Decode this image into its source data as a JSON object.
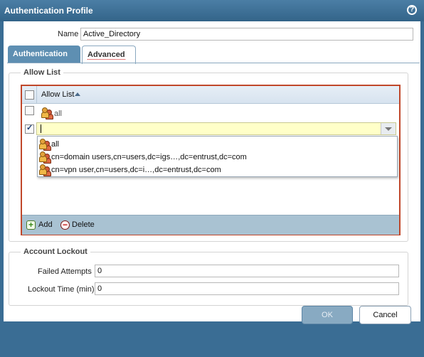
{
  "dialog": {
    "title": "Authentication Profile",
    "help_icon_text": "?"
  },
  "profile": {
    "name_label": "Name",
    "name_value": "Active_Directory"
  },
  "tabs": [
    {
      "label": "Authentication"
    },
    {
      "label": "Advanced"
    }
  ],
  "allow_list": {
    "section_title": "Allow List",
    "column_header": "Allow List",
    "rows": [
      {
        "value": "all",
        "checked": false
      },
      {
        "value": "",
        "checked": true
      }
    ],
    "dropdown_options": [
      "all",
      "cn=domain users,cn=users,dc=igs…,dc=entrust,dc=com",
      "cn=vpn user,cn=users,dc=i…,dc=entrust,dc=com"
    ],
    "add_label": "Add",
    "delete_label": "Delete"
  },
  "account_lockout": {
    "section_title": "Account Lockout",
    "failed_attempts_label": "Failed Attempts",
    "failed_attempts_value": "0",
    "lockout_time_label": "Lockout Time (min)",
    "lockout_time_value": "0"
  },
  "buttons": {
    "ok": "OK",
    "cancel": "Cancel"
  },
  "icons": {
    "help": "help-icon",
    "user_group": "user-group-icon",
    "add": "add-icon",
    "delete": "delete-icon",
    "sort": "sort-ascending-icon",
    "dropdown": "chevron-down-icon"
  },
  "colors": {
    "titlebar": "#3a6d94",
    "highlight_border": "#c0472a",
    "input_highlight": "#ffffc8",
    "tab_active": "#5e8fb2"
  }
}
